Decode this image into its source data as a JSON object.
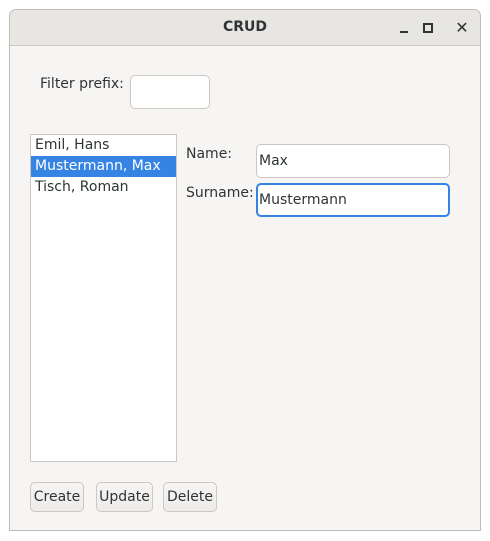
{
  "window": {
    "title": "CRUD"
  },
  "filter": {
    "label": "Filter prefix:",
    "value": ""
  },
  "list": {
    "items": [
      {
        "label": "Emil, Hans",
        "selected": false
      },
      {
        "label": "Mustermann, Max",
        "selected": true
      },
      {
        "label": "Tisch, Roman",
        "selected": false
      }
    ]
  },
  "form": {
    "name_label": "Name:",
    "name_value": "Max",
    "surname_label": "Surname:",
    "surname_value": "Mustermann"
  },
  "buttons": {
    "create": "Create",
    "update": "Update",
    "delete": "Delete"
  },
  "colors": {
    "accent": "#3584e4",
    "window_bg": "#f6f5f4",
    "titlebar_bg": "#e8e6e3"
  },
  "icons": {
    "minimize": "minimize-icon",
    "maximize": "maximize-icon",
    "close": "close-icon"
  }
}
